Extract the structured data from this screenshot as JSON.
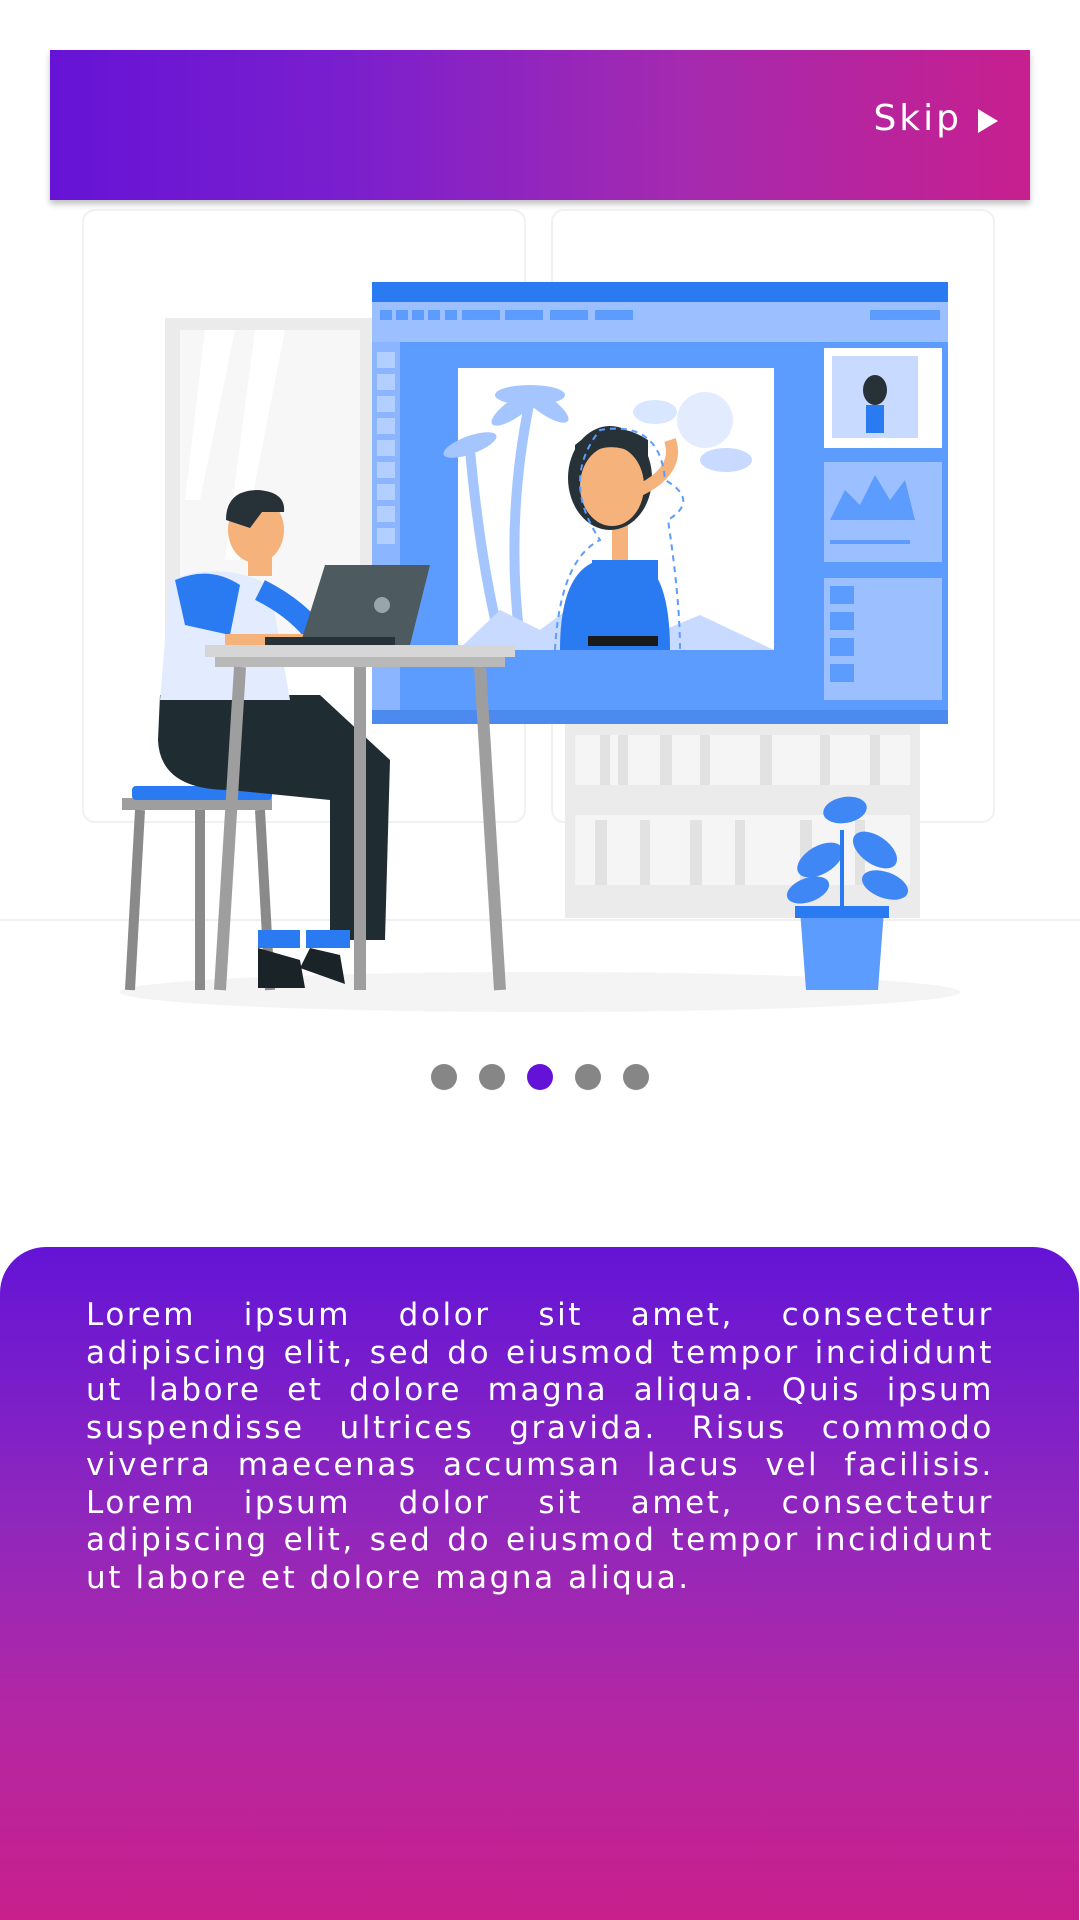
{
  "header": {
    "skip_label": "Skip",
    "gradient_start": "#6613d6",
    "gradient_end": "#c71f8e"
  },
  "illustration": {
    "description_icon": "designer-at-laptop-illustration"
  },
  "pagination": {
    "count": 5,
    "active_index": 2,
    "active_color": "#6512d8",
    "inactive_color": "#868686"
  },
  "panel": {
    "text": "Lorem ipsum dolor sit amet, consectetur adipiscing elit, sed do eiusmod tempor incididunt ut labore et dolore magna aliqua. Quis ipsum suspendisse ultrices gravida. Risus commodo viverra maecenas accumsan lacus vel facilisis. Lorem ipsum dolor sit amet, consectetur adipiscing elit, sed do eiusmod tempor incididunt ut labore et dolore magna aliqua.",
    "gradient_top": "#6414d6",
    "gradient_bottom": "#c81f8c"
  }
}
